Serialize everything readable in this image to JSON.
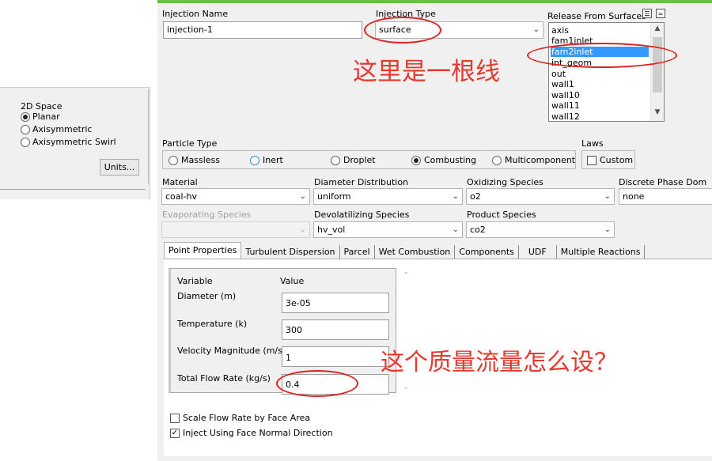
{
  "left_panel": {
    "space_title": "2D Space",
    "options": [
      "Planar",
      "Axisymmetric",
      "Axisymmetric Swirl"
    ],
    "selected": "Planar",
    "units_button": "Units..."
  },
  "injection": {
    "name_label": "Injection Name",
    "name_value": "injection-1",
    "type_label": "Injection Type",
    "type_value": "surface"
  },
  "release": {
    "label": "Release From Surfaces",
    "items": [
      "axis",
      "fam1inlet",
      "fam2inlet",
      "int_geom",
      "out",
      "wall1",
      "wall10",
      "wall11",
      "wall12"
    ],
    "selected": "fam2inlet"
  },
  "particle_type": {
    "label": "Particle Type",
    "options": [
      "Massless",
      "Inert",
      "Droplet",
      "Combusting",
      "Multicomponent"
    ],
    "selected": "Combusting"
  },
  "laws": {
    "label": "Laws",
    "custom_label": "Custom"
  },
  "material": {
    "label": "Material",
    "value": "coal-hv"
  },
  "diameter_distribution": {
    "label": "Diameter Distribution",
    "value": "uniform"
  },
  "oxidizing_species": {
    "label": "Oxidizing Species",
    "value": "o2"
  },
  "discrete_phase_domain": {
    "label": "Discrete Phase Dom",
    "value": "none"
  },
  "evaporating_species": {
    "label": "Evaporating Species",
    "value": ""
  },
  "devolatilizing_species": {
    "label": "Devolatilizing Species",
    "value": "hv_vol"
  },
  "product_species": {
    "label": "Product Species",
    "value": "co2"
  },
  "tabs": [
    "Point Properties",
    "Turbulent Dispersion",
    "Parcel",
    "Wet Combustion",
    "Components",
    "UDF",
    "Multiple Reactions"
  ],
  "active_tab": "Point Properties",
  "point_properties": {
    "variable_header": "Variable",
    "value_header": "Value",
    "rows": [
      {
        "label": "Diameter (m)",
        "value": "3e-05"
      },
      {
        "label": "Temperature (k)",
        "value": "300"
      },
      {
        "label": "Velocity Magnitude (m/s)",
        "value": "1"
      },
      {
        "label": "Total Flow Rate (kg/s)",
        "value": "0.4"
      }
    ]
  },
  "options_bottom": {
    "scale_flow_rate": "Scale Flow Rate by Face Area",
    "inject_normal": "Inject Using Face Normal Direction"
  },
  "annotations": {
    "line_note": "这里是一根线",
    "flow_note": "这个质量流量怎么设？",
    "color": "#e8382e"
  },
  "icons": {
    "dropdown": "chevron-down-icon",
    "scroll_up": "chevron-up-icon",
    "check": "check-icon"
  }
}
